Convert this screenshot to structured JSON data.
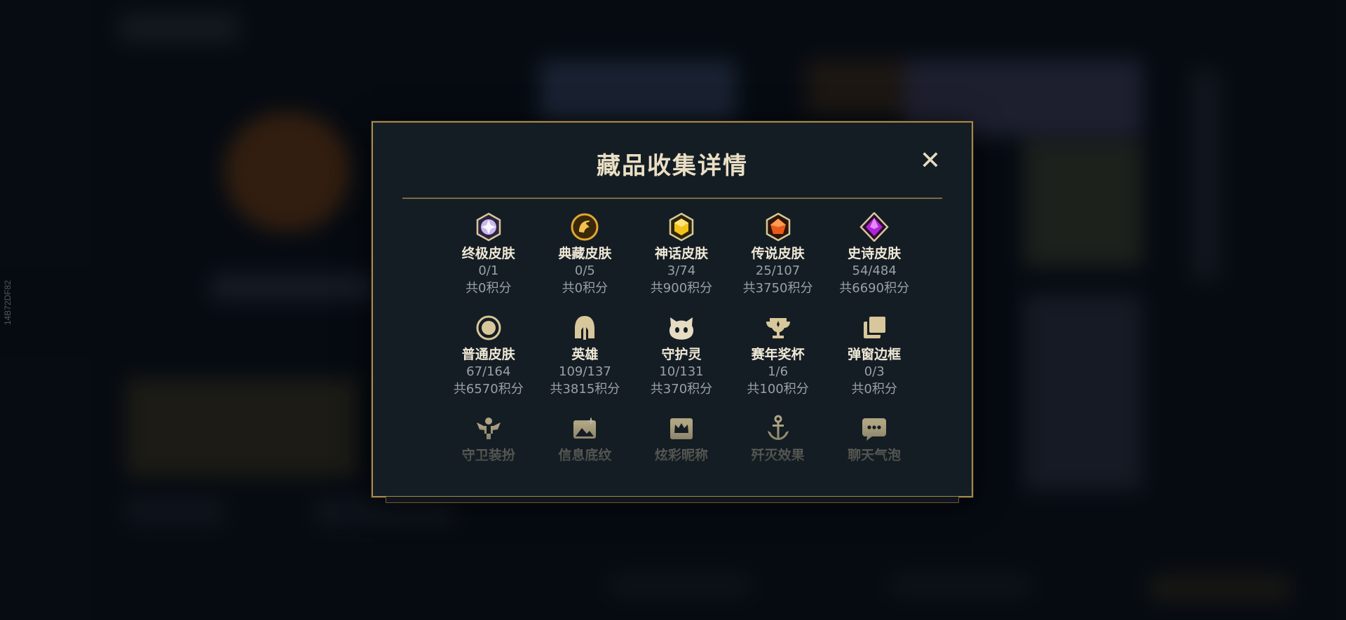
{
  "window": {
    "side_id": "14B72DF82"
  },
  "modal": {
    "title": "藏品收集详情",
    "close_label": "✕"
  },
  "collections": [
    {
      "name": "终极皮肤",
      "count": "0/1",
      "points": "共0积分",
      "icon": "ultimate-gem-icon"
    },
    {
      "name": "典藏皮肤",
      "count": "0/5",
      "points": "共0积分",
      "icon": "dragon-emblem-icon"
    },
    {
      "name": "神话皮肤",
      "count": "3/74",
      "points": "共900积分",
      "icon": "mythic-gem-icon"
    },
    {
      "name": "传说皮肤",
      "count": "25/107",
      "points": "共3750积分",
      "icon": "legendary-gem-icon"
    },
    {
      "name": "史诗皮肤",
      "count": "54/484",
      "points": "共6690积分",
      "icon": "epic-gem-icon"
    },
    {
      "name": "普通皮肤",
      "count": "67/164",
      "points": "共6570积分",
      "icon": "standard-circle-icon"
    },
    {
      "name": "英雄",
      "count": "109/137",
      "points": "共3815积分",
      "icon": "helmet-icon"
    },
    {
      "name": "守护灵",
      "count": "10/131",
      "points": "共370积分",
      "icon": "little-legend-icon"
    },
    {
      "name": "赛年奖杯",
      "count": "1/6",
      "points": "共100积分",
      "icon": "trophy-icon"
    },
    {
      "name": "弹窗边框",
      "count": "0/3",
      "points": "共0积分",
      "icon": "border-frame-icon"
    },
    {
      "name": "守卫装扮",
      "icon": "ward-skin-icon"
    },
    {
      "name": "信息底纹",
      "icon": "banner-image-icon"
    },
    {
      "name": "炫彩昵称",
      "icon": "nameplate-crown-icon"
    },
    {
      "name": "歼灭效果",
      "icon": "anchor-effect-icon"
    },
    {
      "name": "聊天气泡",
      "icon": "chat-bubble-icon"
    }
  ],
  "colors": {
    "gold_border": "#a88a4e",
    "icon_gold": "#d8c79a",
    "modal_bg": "#141d24"
  }
}
